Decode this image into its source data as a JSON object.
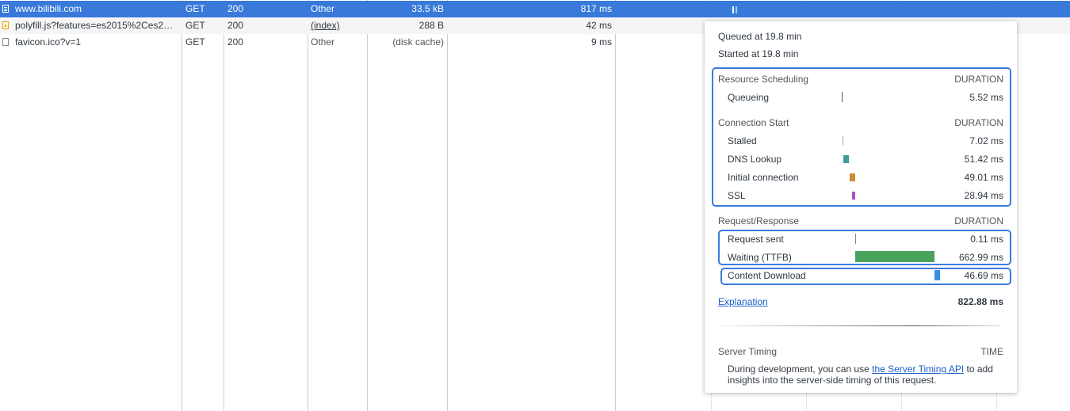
{
  "requests": [
    {
      "name": "www.bilibili.com",
      "method": "GET",
      "status": "200",
      "type": "Other",
      "size": "33.5 kB",
      "time": "817 ms"
    },
    {
      "name": "polyfill.js?features=es2015%2Ces2…",
      "method": "GET",
      "status": "200",
      "type": "(index)",
      "size": "288 B",
      "time": "42 ms"
    },
    {
      "name": "favicon.ico?v=1",
      "method": "GET",
      "status": "200",
      "type": "Other",
      "size": "(disk cache)",
      "time": "9 ms"
    }
  ],
  "timing": {
    "queued_at": "Queued at 19.8 min",
    "started_at": "Started at 19.8 min",
    "resource_scheduling": {
      "title": "Resource Scheduling",
      "duration_label": "DURATION",
      "items": [
        {
          "label": "Queueing",
          "value": "5.52 ms",
          "color": "#555555"
        }
      ]
    },
    "connection_start": {
      "title": "Connection Start",
      "duration_label": "DURATION",
      "items": [
        {
          "label": "Stalled",
          "value": "7.02 ms",
          "color": "#aaaaaa"
        },
        {
          "label": "DNS Lookup",
          "value": "51.42 ms",
          "color": "#3f9e95"
        },
        {
          "label": "Initial connection",
          "value": "49.01 ms",
          "color": "#d08a34"
        },
        {
          "label": "SSL",
          "value": "28.94 ms",
          "color": "#b04fc9"
        }
      ]
    },
    "request_response": {
      "title": "Request/Response",
      "duration_label": "DURATION",
      "items": [
        {
          "label": "Request sent",
          "value": "0.11 ms",
          "color": "#888888"
        },
        {
          "label": "Waiting (TTFB)",
          "value": "662.99 ms",
          "color": "#4aa35a"
        },
        {
          "label": "Content Download",
          "value": "46.69 ms",
          "color": "#3d8fe0"
        }
      ]
    },
    "explanation_link": "Explanation",
    "total": "822.88 ms",
    "server_timing": {
      "title": "Server Timing",
      "time_label": "TIME",
      "text_before": "During development, you can use ",
      "link": "the Server Timing API",
      "text_after": " to add",
      "text_line2": "insights into the server-side timing of this request."
    }
  },
  "colors": {
    "selected_row": "#3879d9",
    "highlight_border": "#3b7be0",
    "ttfb": "#4aa35a",
    "download": "#3d8fe0"
  }
}
